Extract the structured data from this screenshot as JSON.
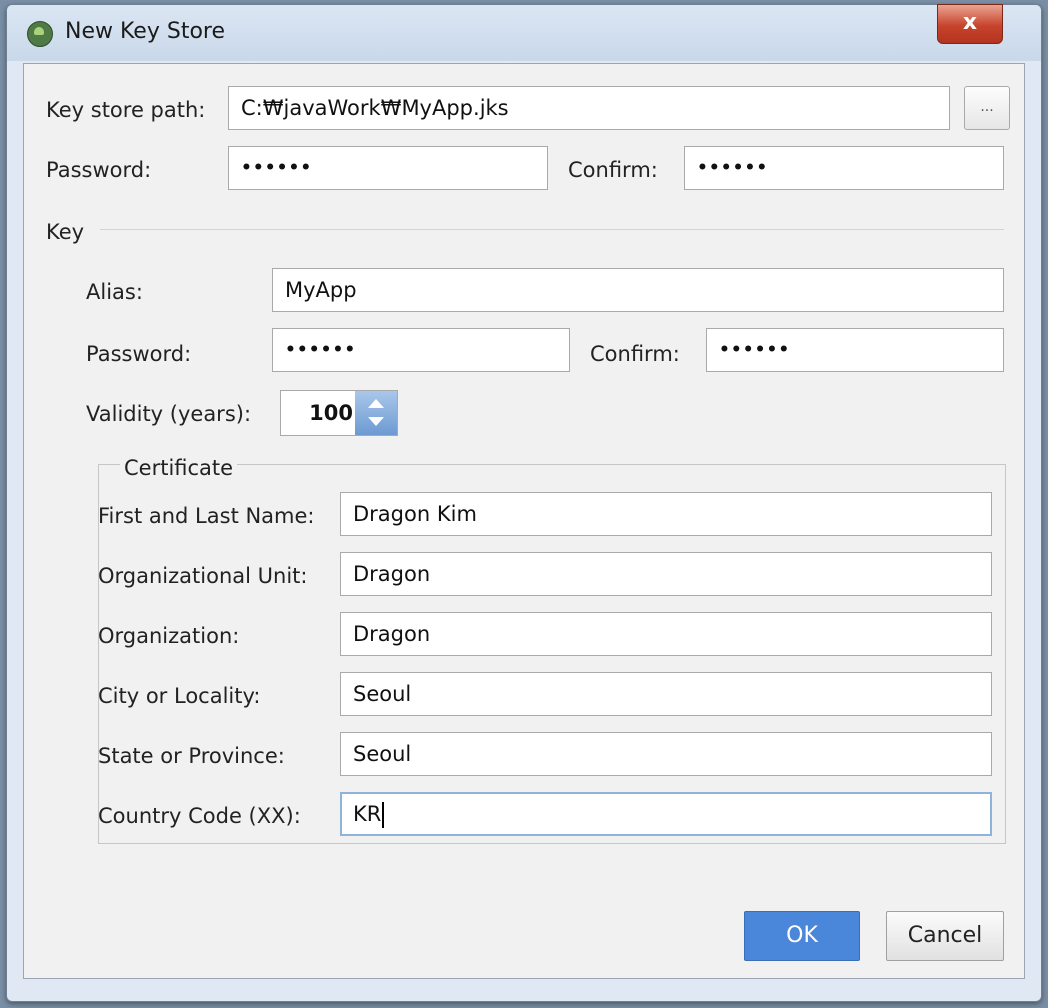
{
  "window": {
    "title": "New Key Store",
    "close_glyph": "x"
  },
  "keystore": {
    "path_label": "Key store path:",
    "path_value": "C:₩javaWork₩MyApp.jks",
    "browse_label": "...",
    "password_label": "Password:",
    "password_value": "••••••",
    "confirm_label": "Confirm:",
    "confirm_value": "••••••"
  },
  "key": {
    "section_label": "Key",
    "alias_label": "Alias:",
    "alias_value": "MyApp",
    "password_label": "Password:",
    "password_value": "••••••",
    "confirm_label": "Confirm:",
    "confirm_value": "••••••",
    "validity_label": "Validity (years):",
    "validity_value": "100"
  },
  "certificate": {
    "section_label": "Certificate",
    "name_label": "First and Last Name:",
    "name_value": "Dragon Kim",
    "org_unit_label": "Organizational Unit:",
    "org_unit_value": "Dragon",
    "org_label": "Organization:",
    "org_value": "Dragon",
    "city_label": "City or Locality:",
    "city_value": "Seoul",
    "state_label": "State or Province:",
    "state_value": "Seoul",
    "country_label": "Country Code (XX):",
    "country_value": "KR"
  },
  "buttons": {
    "ok": "OK",
    "cancel": "Cancel"
  },
  "colors": {
    "ok_button": "#4a86d9",
    "close_button": "#c7432c",
    "spinner_accent": "#6d9ad2"
  }
}
